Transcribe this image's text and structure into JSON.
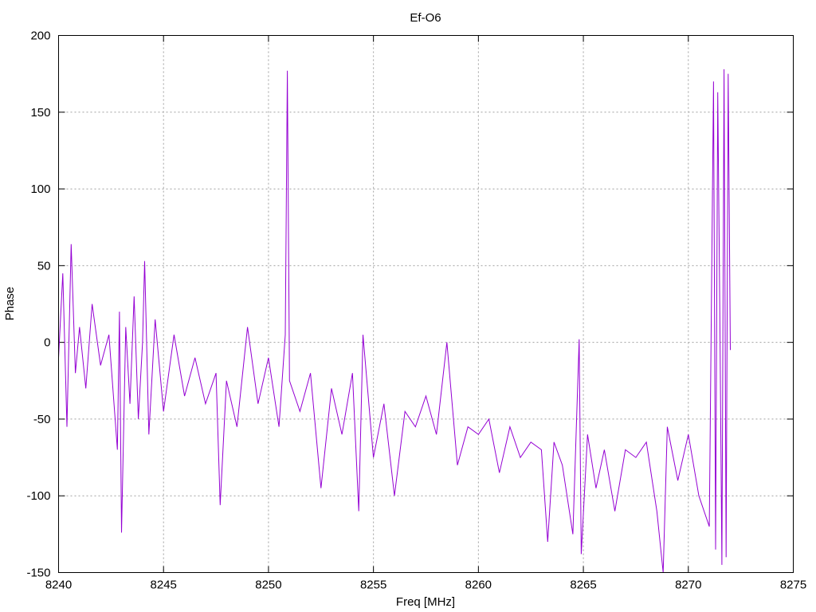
{
  "chart_data": {
    "type": "line",
    "title": "Ef-O6",
    "xlabel": "Freq [MHz]",
    "ylabel": "Phase",
    "xlim": [
      8240,
      8275
    ],
    "ylim": [
      -150,
      200
    ],
    "xticks": [
      8240,
      8245,
      8250,
      8255,
      8260,
      8265,
      8270,
      8275
    ],
    "yticks": [
      -150,
      -100,
      -50,
      0,
      50,
      100,
      150,
      200
    ],
    "grid": true,
    "legend": "none",
    "series": [
      {
        "color": "#9400d3",
        "x": [
          8240.0,
          8240.2,
          8240.4,
          8240.6,
          8240.8,
          8241.0,
          8241.3,
          8241.6,
          8242.0,
          8242.4,
          8242.8,
          8242.9,
          8243.0,
          8243.2,
          8243.4,
          8243.6,
          8243.8,
          8244.0,
          8244.1,
          8244.3,
          8244.6,
          8245.0,
          8245.5,
          8246.0,
          8246.5,
          8247.0,
          8247.5,
          8247.7,
          8248.0,
          8248.5,
          8249.0,
          8249.5,
          8250.0,
          8250.5,
          8250.8,
          8250.9,
          8251.0,
          8251.5,
          8252.0,
          8252.5,
          8253.0,
          8253.5,
          8254.0,
          8254.3,
          8254.5,
          8255.0,
          8255.5,
          8256.0,
          8256.5,
          8257.0,
          8257.5,
          8258.0,
          8258.5,
          8259.0,
          8259.5,
          8260.0,
          8260.5,
          8261.0,
          8261.5,
          8262.0,
          8262.5,
          8263.0,
          8263.3,
          8263.6,
          8264.0,
          8264.5,
          8264.8,
          8264.9,
          8265.2,
          8265.6,
          8266.0,
          8266.5,
          8267.0,
          8267.5,
          8268.0,
          8268.5,
          8268.8,
          8269.0,
          8269.5,
          8270.0,
          8270.5,
          8271.0,
          8271.2,
          8271.3,
          8271.4,
          8271.5,
          8271.6,
          8271.7,
          8271.8,
          8271.9,
          8272.0
        ],
        "y": [
          -10,
          45,
          -55,
          64,
          -20,
          10,
          -30,
          25,
          -15,
          5,
          -70,
          20,
          -124,
          10,
          -40,
          30,
          -50,
          0,
          53,
          -60,
          15,
          -45,
          5,
          -35,
          -10,
          -40,
          -20,
          -106,
          -25,
          -55,
          10,
          -40,
          -10,
          -55,
          5,
          177,
          -25,
          -45,
          -20,
          -95,
          -30,
          -60,
          -20,
          -110,
          5,
          -75,
          -40,
          -100,
          -45,
          -55,
          -35,
          -60,
          0,
          -80,
          -55,
          -60,
          -50,
          -85,
          -55,
          -75,
          -65,
          -70,
          -130,
          -65,
          -80,
          -125,
          2,
          -138,
          -60,
          -95,
          -70,
          -110,
          -70,
          -75,
          -65,
          -110,
          -150,
          -55,
          -90,
          -60,
          -100,
          -120,
          170,
          -135,
          163,
          20,
          -145,
          178,
          -140,
          175,
          -5
        ]
      }
    ]
  }
}
